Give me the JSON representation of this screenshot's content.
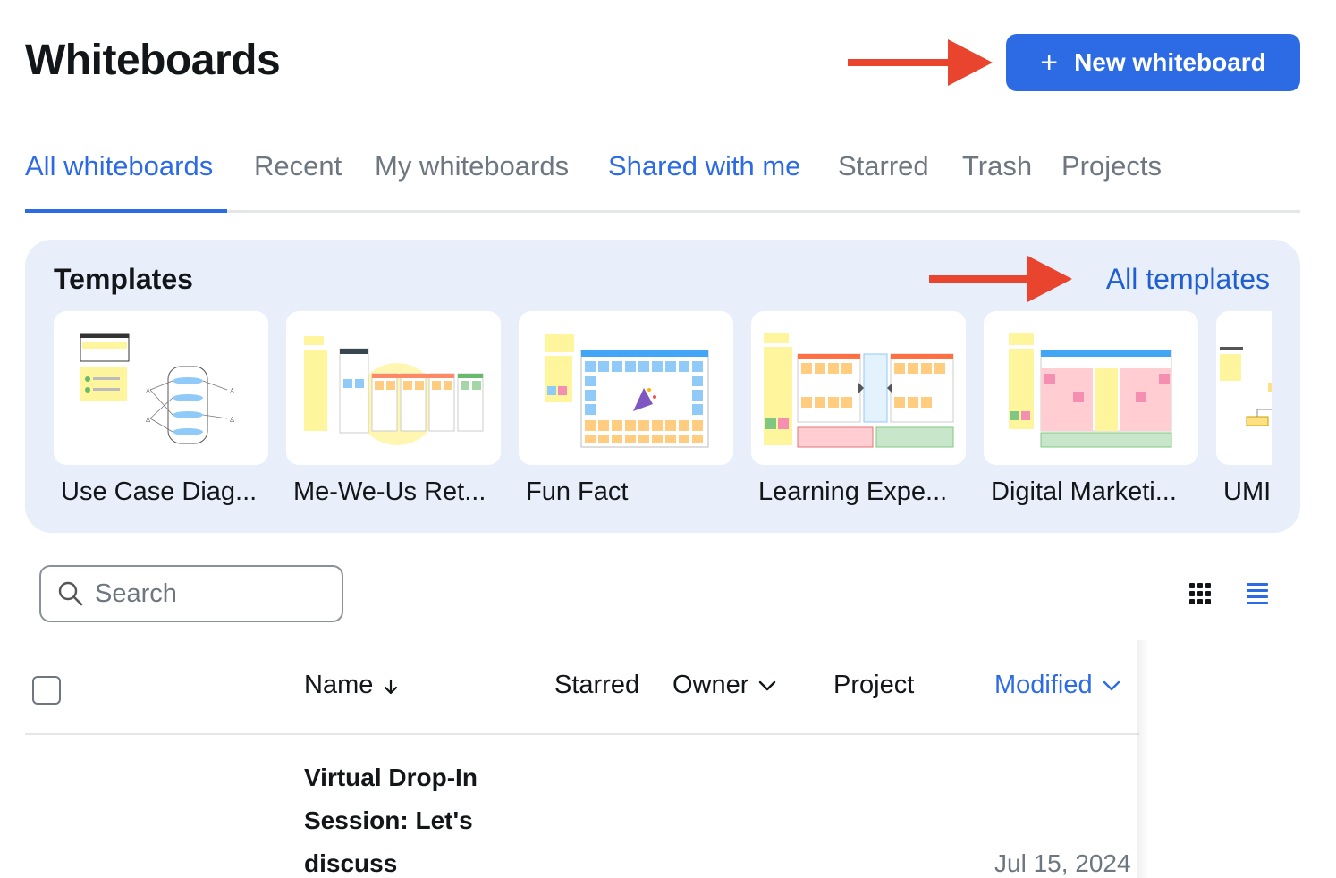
{
  "header": {
    "title": "Whiteboards",
    "new_button": "New whiteboard"
  },
  "tabs": [
    {
      "label": "All whiteboards"
    },
    {
      "label": "Recent"
    },
    {
      "label": "My whiteboards"
    },
    {
      "label": "Shared with me"
    },
    {
      "label": "Starred"
    },
    {
      "label": "Trash"
    },
    {
      "label": "Projects"
    }
  ],
  "templates": {
    "title": "Templates",
    "all_link": "All templates",
    "cards": [
      {
        "label": "Use Case Diag..."
      },
      {
        "label": "Me-We-Us Ret..."
      },
      {
        "label": "Fun Fact"
      },
      {
        "label": "Learning Expe..."
      },
      {
        "label": "Digital Marketi..."
      },
      {
        "label": "UMI"
      }
    ]
  },
  "search": {
    "placeholder": "Search"
  },
  "table": {
    "columns": {
      "name": "Name",
      "starred": "Starred",
      "owner": "Owner",
      "project": "Project",
      "modified": "Modified"
    },
    "rows": [
      {
        "name": "Virtual Drop-In Session: Let's discuss",
        "modified": "Jul 15, 2024"
      }
    ]
  },
  "colors": {
    "accent": "#2d6be4",
    "annotation_arrow": "#e8442e",
    "templates_bg": "#e8eefa"
  }
}
